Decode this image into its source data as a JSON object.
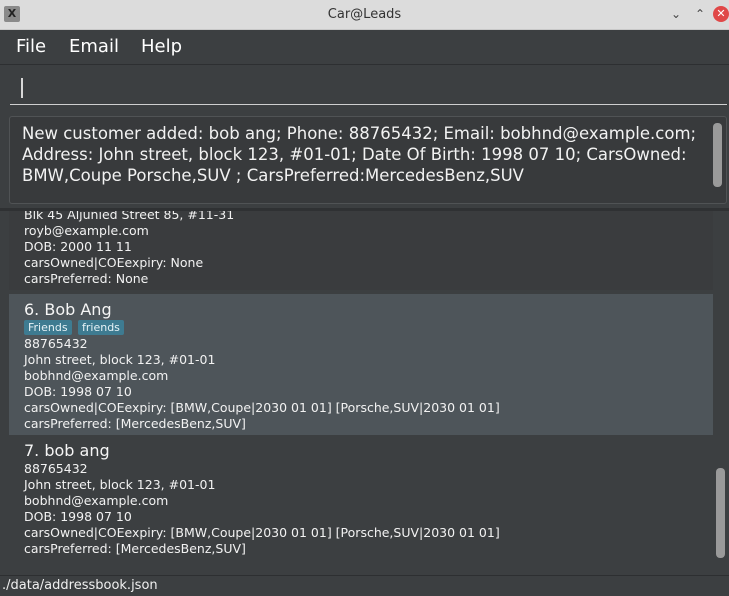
{
  "window": {
    "title": "Car@Leads",
    "minimize_icon": "chevron-down",
    "maximize_icon": "chevron-up",
    "close_icon": "close-x"
  },
  "menu": {
    "file": "File",
    "email": "Email",
    "help": "Help"
  },
  "command": {
    "value": ""
  },
  "result": {
    "text": "New customer added: bob ang; Phone: 88765432; Email: bobhnd@example.com; Address: John street, block 123, #01-01; Date Of Birth: 1998 07 10; CarsOwned: BMW,Coupe Porsche,SUV ; CarsPreferred:MercedesBenz,SUV"
  },
  "list": {
    "partial": {
      "address": "Blk 45 Aljunied Street 85, #11-31",
      "email": "royb@example.com",
      "dob": "DOB: 2000 11 11",
      "cars_owned": "carsOwned|COEexpiry: None",
      "cars_preferred": "carsPreferred: None"
    },
    "selected": {
      "name": "6.  Bob Ang",
      "tags": [
        "Friends",
        "friends"
      ],
      "phone": "88765432",
      "address": "John street, block 123, #01-01",
      "email": "bobhnd@example.com",
      "dob": "DOB: 1998 07 10",
      "cars_owned": "carsOwned|COEexpiry: [BMW,Coupe|2030 01 01] [Porsche,SUV|2030 01 01]",
      "cars_preferred": "carsPreferred: [MercedesBenz,SUV]"
    },
    "third": {
      "name": "7.  bob ang",
      "phone": "88765432",
      "address": "John street, block 123, #01-01",
      "email": "bobhnd@example.com",
      "dob": "DOB: 1998 07 10",
      "cars_owned": "carsOwned|COEexpiry: [BMW,Coupe|2030 01 01] [Porsche,SUV|2030 01 01]",
      "cars_preferred": "carsPreferred: [MercedesBenz,SUV]"
    }
  },
  "status": {
    "path": "./data/addressbook.json"
  },
  "colors": {
    "background": "#3c3f41",
    "selected_card": "#4e555a",
    "tag": "#3e7b91",
    "close": "#e04848"
  }
}
